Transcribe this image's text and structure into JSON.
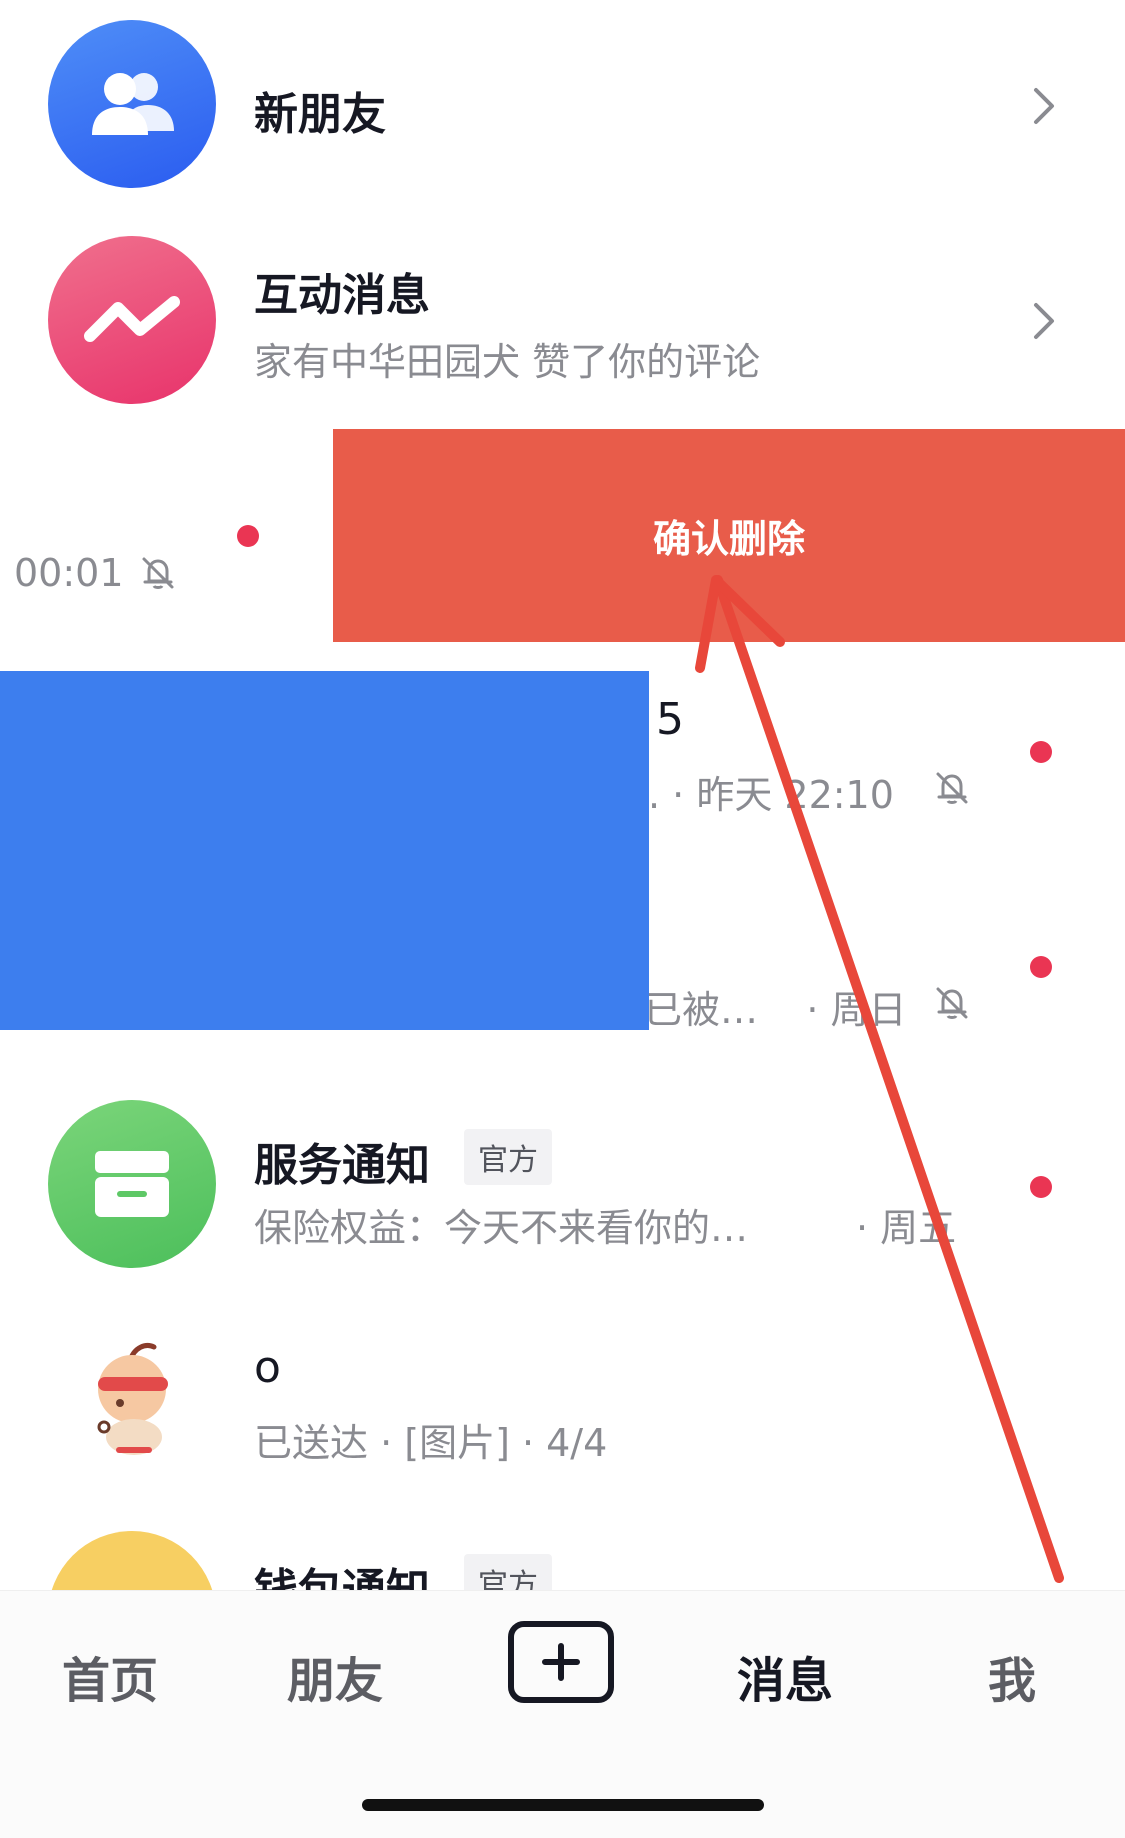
{
  "rows": {
    "new_friends": {
      "title": "新朋友"
    },
    "interactions": {
      "title": "互动消息",
      "subtitle": "家有中华田园犬 赞了你的评论"
    },
    "swiped": {
      "time": "00:01",
      "delete_label": "确认删除"
    },
    "redacted_1": {
      "title_fragment": "5",
      "meta": ". · 昨天 22:10"
    },
    "redacted_2": {
      "meta": "已被…    · 周日"
    },
    "service": {
      "title": "服务通知",
      "badge": "官方",
      "subtitle": "保险权益：今天不来看你的…",
      "time": "· 周五"
    },
    "user_o": {
      "title": "o",
      "subtitle": "已送达 · [图片] · 4/4"
    },
    "wallet": {
      "title": "钱包通知",
      "badge": "官方"
    }
  },
  "tabbar": {
    "home": "首页",
    "friends": "朋友",
    "messages": "消息",
    "me": "我"
  },
  "colors": {
    "delete": "#e85c4a",
    "redaction": "#3d7eee",
    "unread_dot": "#ea3553",
    "annotation_arrow": "#e8473a"
  },
  "icons": {
    "new_friends": "people-icon",
    "interactions": "zigzag-icon",
    "service": "inbox-icon",
    "mute": "bell-off-icon",
    "chevron": "chevron-right-icon",
    "plus": "plus-icon"
  }
}
